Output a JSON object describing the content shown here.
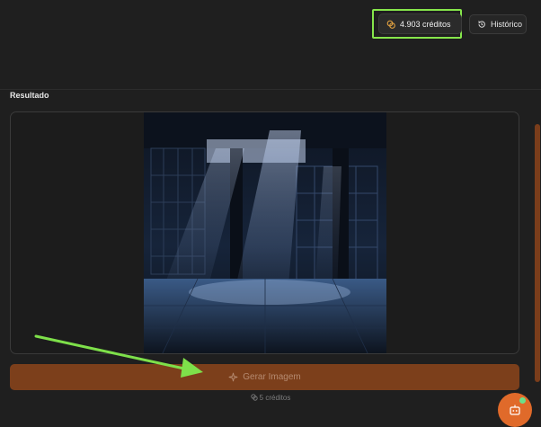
{
  "toolbar": {
    "credits_label": "4.903 créditos",
    "history_label": "Histórico"
  },
  "result": {
    "title": "Resultado",
    "image_alt": "Imagem gerada"
  },
  "generate": {
    "button_label": "Gerar Imagem",
    "cost_label": "5 créditos"
  },
  "icons": {
    "credits": "coins-icon",
    "history": "history-icon",
    "generate": "sparkle-icon",
    "cost": "coins-icon",
    "chat": "chat-bot-icon"
  },
  "colors": {
    "background": "#1f1f1f",
    "accent": "#7c3f1b",
    "fab": "#e06a2a",
    "highlight": "#86e64b",
    "badge": "#6be08a"
  }
}
